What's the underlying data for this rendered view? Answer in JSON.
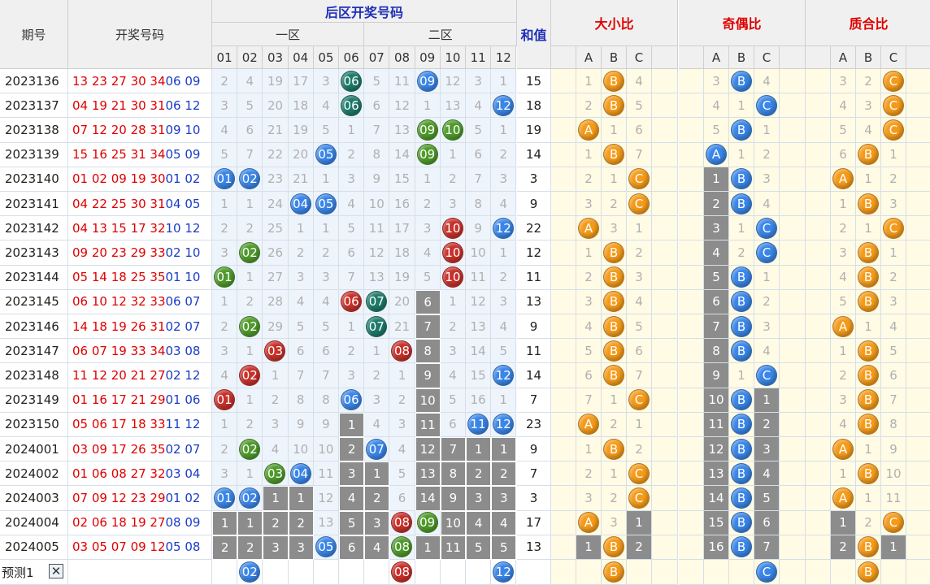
{
  "header": {
    "period": "期号",
    "draw": "开奖号码",
    "back_zone": "后区开奖号码",
    "zone1": "一区",
    "zone2": "二区",
    "sum": "和值",
    "big_small": "大小比",
    "odd_even": "奇偶比",
    "prime_comp": "质合比",
    "ball_cols": [
      "01",
      "02",
      "03",
      "04",
      "05",
      "06",
      "07",
      "08",
      "09",
      "10",
      "11",
      "12"
    ],
    "abc": [
      "A",
      "B",
      "C"
    ]
  },
  "rows": [
    {
      "period": "2023136",
      "front": "13 23 27 30 34",
      "back": "06 09",
      "miss": [
        "2",
        "4",
        "19",
        "17",
        "3",
        "06",
        "5",
        "11",
        "09",
        "12",
        "3",
        "1"
      ],
      "sum": "15",
      "bs": [
        "1",
        "B",
        "4"
      ],
      "oe": [
        "3",
        "B",
        "4"
      ],
      "pc": [
        "3",
        "2",
        "C"
      ]
    },
    {
      "period": "2023137",
      "front": "04 19 21 30 31",
      "back": "06 12",
      "miss": [
        "3",
        "5",
        "20",
        "18",
        "4",
        "06",
        "6",
        "12",
        "1",
        "13",
        "4",
        "12"
      ],
      "sum": "18",
      "bs": [
        "2",
        "B",
        "5"
      ],
      "oe": [
        "4",
        "1",
        "C"
      ],
      "pc": [
        "4",
        "3",
        "C"
      ]
    },
    {
      "period": "2023138",
      "front": "07 12 20 28 31",
      "back": "09 10",
      "miss": [
        "4",
        "6",
        "21",
        "19",
        "5",
        "1",
        "7",
        "13",
        "09",
        "10",
        "5",
        "1"
      ],
      "sum": "19",
      "bs": [
        "A",
        "1",
        "6"
      ],
      "oe": [
        "5",
        "B",
        "1"
      ],
      "pc": [
        "5",
        "4",
        "C"
      ]
    },
    {
      "period": "2023139",
      "front": "15 16 25 31 34",
      "back": "05 09",
      "miss": [
        "5",
        "7",
        "22",
        "20",
        "05",
        "2",
        "8",
        "14",
        "09",
        "1",
        "6",
        "2"
      ],
      "sum": "14",
      "bs": [
        "1",
        "B",
        "7"
      ],
      "oe": [
        "A",
        "1",
        "2"
      ],
      "pc": [
        "6",
        "B",
        "1"
      ]
    },
    {
      "period": "2023140",
      "front": "01 02 09 19 30",
      "back": "01 02",
      "miss": [
        "01",
        "02",
        "23",
        "21",
        "1",
        "3",
        "9",
        "15",
        "1",
        "2",
        "7",
        "3"
      ],
      "sum": "3",
      "bs": [
        "2",
        "1",
        "C"
      ],
      "oe": [
        "1",
        "B",
        "3"
      ],
      "pc": [
        "A",
        "1",
        "2"
      ]
    },
    {
      "period": "2023141",
      "front": "04 22 25 30 31",
      "back": "04 05",
      "miss": [
        "1",
        "1",
        "24",
        "04",
        "05",
        "4",
        "10",
        "16",
        "2",
        "3",
        "8",
        "4"
      ],
      "sum": "9",
      "bs": [
        "3",
        "2",
        "C"
      ],
      "oe": [
        "2",
        "B",
        "4"
      ],
      "pc": [
        "1",
        "B",
        "3"
      ]
    },
    {
      "period": "2023142",
      "front": "04 13 15 17 32",
      "back": "10 12",
      "miss": [
        "2",
        "2",
        "25",
        "1",
        "1",
        "5",
        "11",
        "17",
        "3",
        "10",
        "9",
        "12"
      ],
      "sum": "22",
      "bs": [
        "A",
        "3",
        "1"
      ],
      "oe": [
        "3",
        "1",
        "C"
      ],
      "pc": [
        "2",
        "1",
        "C"
      ]
    },
    {
      "period": "2023143",
      "front": "09 20 23 29 33",
      "back": "02 10",
      "miss": [
        "3",
        "02",
        "26",
        "2",
        "2",
        "6",
        "12",
        "18",
        "4",
        "10",
        "10",
        "1"
      ],
      "sum": "12",
      "bs": [
        "1",
        "B",
        "2"
      ],
      "oe": [
        "4",
        "2",
        "C"
      ],
      "pc": [
        "3",
        "B",
        "1"
      ]
    },
    {
      "period": "2023144",
      "front": "05 14 18 25 35",
      "back": "01 10",
      "miss": [
        "01",
        "1",
        "27",
        "3",
        "3",
        "7",
        "13",
        "19",
        "5",
        "10",
        "11",
        "2"
      ],
      "sum": "11",
      "bs": [
        "2",
        "B",
        "3"
      ],
      "oe": [
        "5",
        "B",
        "1"
      ],
      "pc": [
        "4",
        "B",
        "2"
      ]
    },
    {
      "period": "2023145",
      "front": "06 10 12 32 33",
      "back": "06 07",
      "miss": [
        "1",
        "2",
        "28",
        "4",
        "4",
        "06",
        "07",
        "20",
        "6",
        "1",
        "12",
        "3"
      ],
      "sum": "13",
      "bs": [
        "3",
        "B",
        "4"
      ],
      "oe": [
        "6",
        "B",
        "2"
      ],
      "pc": [
        "5",
        "B",
        "3"
      ]
    },
    {
      "period": "2023146",
      "front": "14 18 19 26 31",
      "back": "02 07",
      "miss": [
        "2",
        "02",
        "29",
        "5",
        "5",
        "1",
        "07",
        "21",
        "7",
        "2",
        "13",
        "4"
      ],
      "sum": "9",
      "bs": [
        "4",
        "B",
        "5"
      ],
      "oe": [
        "7",
        "B",
        "3"
      ],
      "pc": [
        "A",
        "1",
        "4"
      ]
    },
    {
      "period": "2023147",
      "front": "06 07 19 33 34",
      "back": "03 08",
      "miss": [
        "3",
        "1",
        "03",
        "6",
        "6",
        "2",
        "1",
        "08",
        "8",
        "3",
        "14",
        "5"
      ],
      "sum": "11",
      "bs": [
        "5",
        "B",
        "6"
      ],
      "oe": [
        "8",
        "B",
        "4"
      ],
      "pc": [
        "1",
        "B",
        "5"
      ]
    },
    {
      "period": "2023148",
      "front": "11 12 20 21 27",
      "back": "02 12",
      "miss": [
        "4",
        "02",
        "1",
        "7",
        "7",
        "3",
        "2",
        "1",
        "9",
        "4",
        "15",
        "12"
      ],
      "sum": "14",
      "bs": [
        "6",
        "B",
        "7"
      ],
      "oe": [
        "9",
        "1",
        "C"
      ],
      "pc": [
        "2",
        "B",
        "6"
      ]
    },
    {
      "period": "2023149",
      "front": "01 16 17 21 29",
      "back": "01 06",
      "miss": [
        "01",
        "1",
        "2",
        "8",
        "8",
        "06",
        "3",
        "2",
        "10",
        "5",
        "16",
        "1"
      ],
      "sum": "7",
      "bs": [
        "7",
        "1",
        "C"
      ],
      "oe": [
        "10",
        "B",
        "1"
      ],
      "pc": [
        "3",
        "B",
        "7"
      ]
    },
    {
      "period": "2023150",
      "front": "05 06 17 18 33",
      "back": "11 12",
      "miss": [
        "1",
        "2",
        "3",
        "9",
        "9",
        "1",
        "4",
        "3",
        "11",
        "6",
        "11",
        "12"
      ],
      "sum": "23",
      "bs": [
        "A",
        "2",
        "1"
      ],
      "oe": [
        "11",
        "B",
        "2"
      ],
      "pc": [
        "4",
        "B",
        "8"
      ]
    },
    {
      "period": "2024001",
      "front": "03 09 17 26 35",
      "back": "02 07",
      "miss": [
        "2",
        "02",
        "4",
        "10",
        "10",
        "2",
        "07",
        "4",
        "12",
        "7",
        "1",
        "1"
      ],
      "sum": "9",
      "bs": [
        "1",
        "B",
        "2"
      ],
      "oe": [
        "12",
        "B",
        "3"
      ],
      "pc": [
        "A",
        "1",
        "9"
      ]
    },
    {
      "period": "2024002",
      "front": "01 06 08 27 32",
      "back": "03 04",
      "miss": [
        "3",
        "1",
        "03",
        "04",
        "11",
        "3",
        "1",
        "5",
        "13",
        "8",
        "2",
        "2"
      ],
      "sum": "7",
      "bs": [
        "2",
        "1",
        "C"
      ],
      "oe": [
        "13",
        "B",
        "4"
      ],
      "pc": [
        "1",
        "B",
        "10"
      ]
    },
    {
      "period": "2024003",
      "front": "07 09 12 23 29",
      "back": "01 02",
      "miss": [
        "01",
        "02",
        "1",
        "1",
        "12",
        "4",
        "2",
        "6",
        "14",
        "9",
        "3",
        "3"
      ],
      "sum": "3",
      "bs": [
        "3",
        "2",
        "C"
      ],
      "oe": [
        "14",
        "B",
        "5"
      ],
      "pc": [
        "A",
        "1",
        "11"
      ]
    },
    {
      "period": "2024004",
      "front": "02 06 18 19 27",
      "back": "08 09",
      "miss": [
        "1",
        "1",
        "2",
        "2",
        "13",
        "5",
        "3",
        "08",
        "09",
        "10",
        "4",
        "4"
      ],
      "sum": "17",
      "bs": [
        "A",
        "3",
        "1"
      ],
      "oe": [
        "15",
        "B",
        "6"
      ],
      "pc": [
        "1",
        "2",
        "C"
      ]
    },
    {
      "period": "2024005",
      "front": "03 05 07 09 12",
      "back": "05 08",
      "miss": [
        "2",
        "2",
        "3",
        "3",
        "05",
        "6",
        "4",
        "08",
        "1",
        "11",
        "5",
        "5"
      ],
      "sum": "13",
      "bs": [
        "1",
        "B",
        "2"
      ],
      "oe": [
        "16",
        "B",
        "7"
      ],
      "pc": [
        "2",
        "B",
        "1"
      ]
    }
  ],
  "footer": {
    "label": "预测1",
    "close": "✕",
    "pred_balls": [
      "02",
      "08",
      "12"
    ],
    "pred_bs": "B",
    "pred_oe": "C",
    "pred_pc": "B"
  }
}
